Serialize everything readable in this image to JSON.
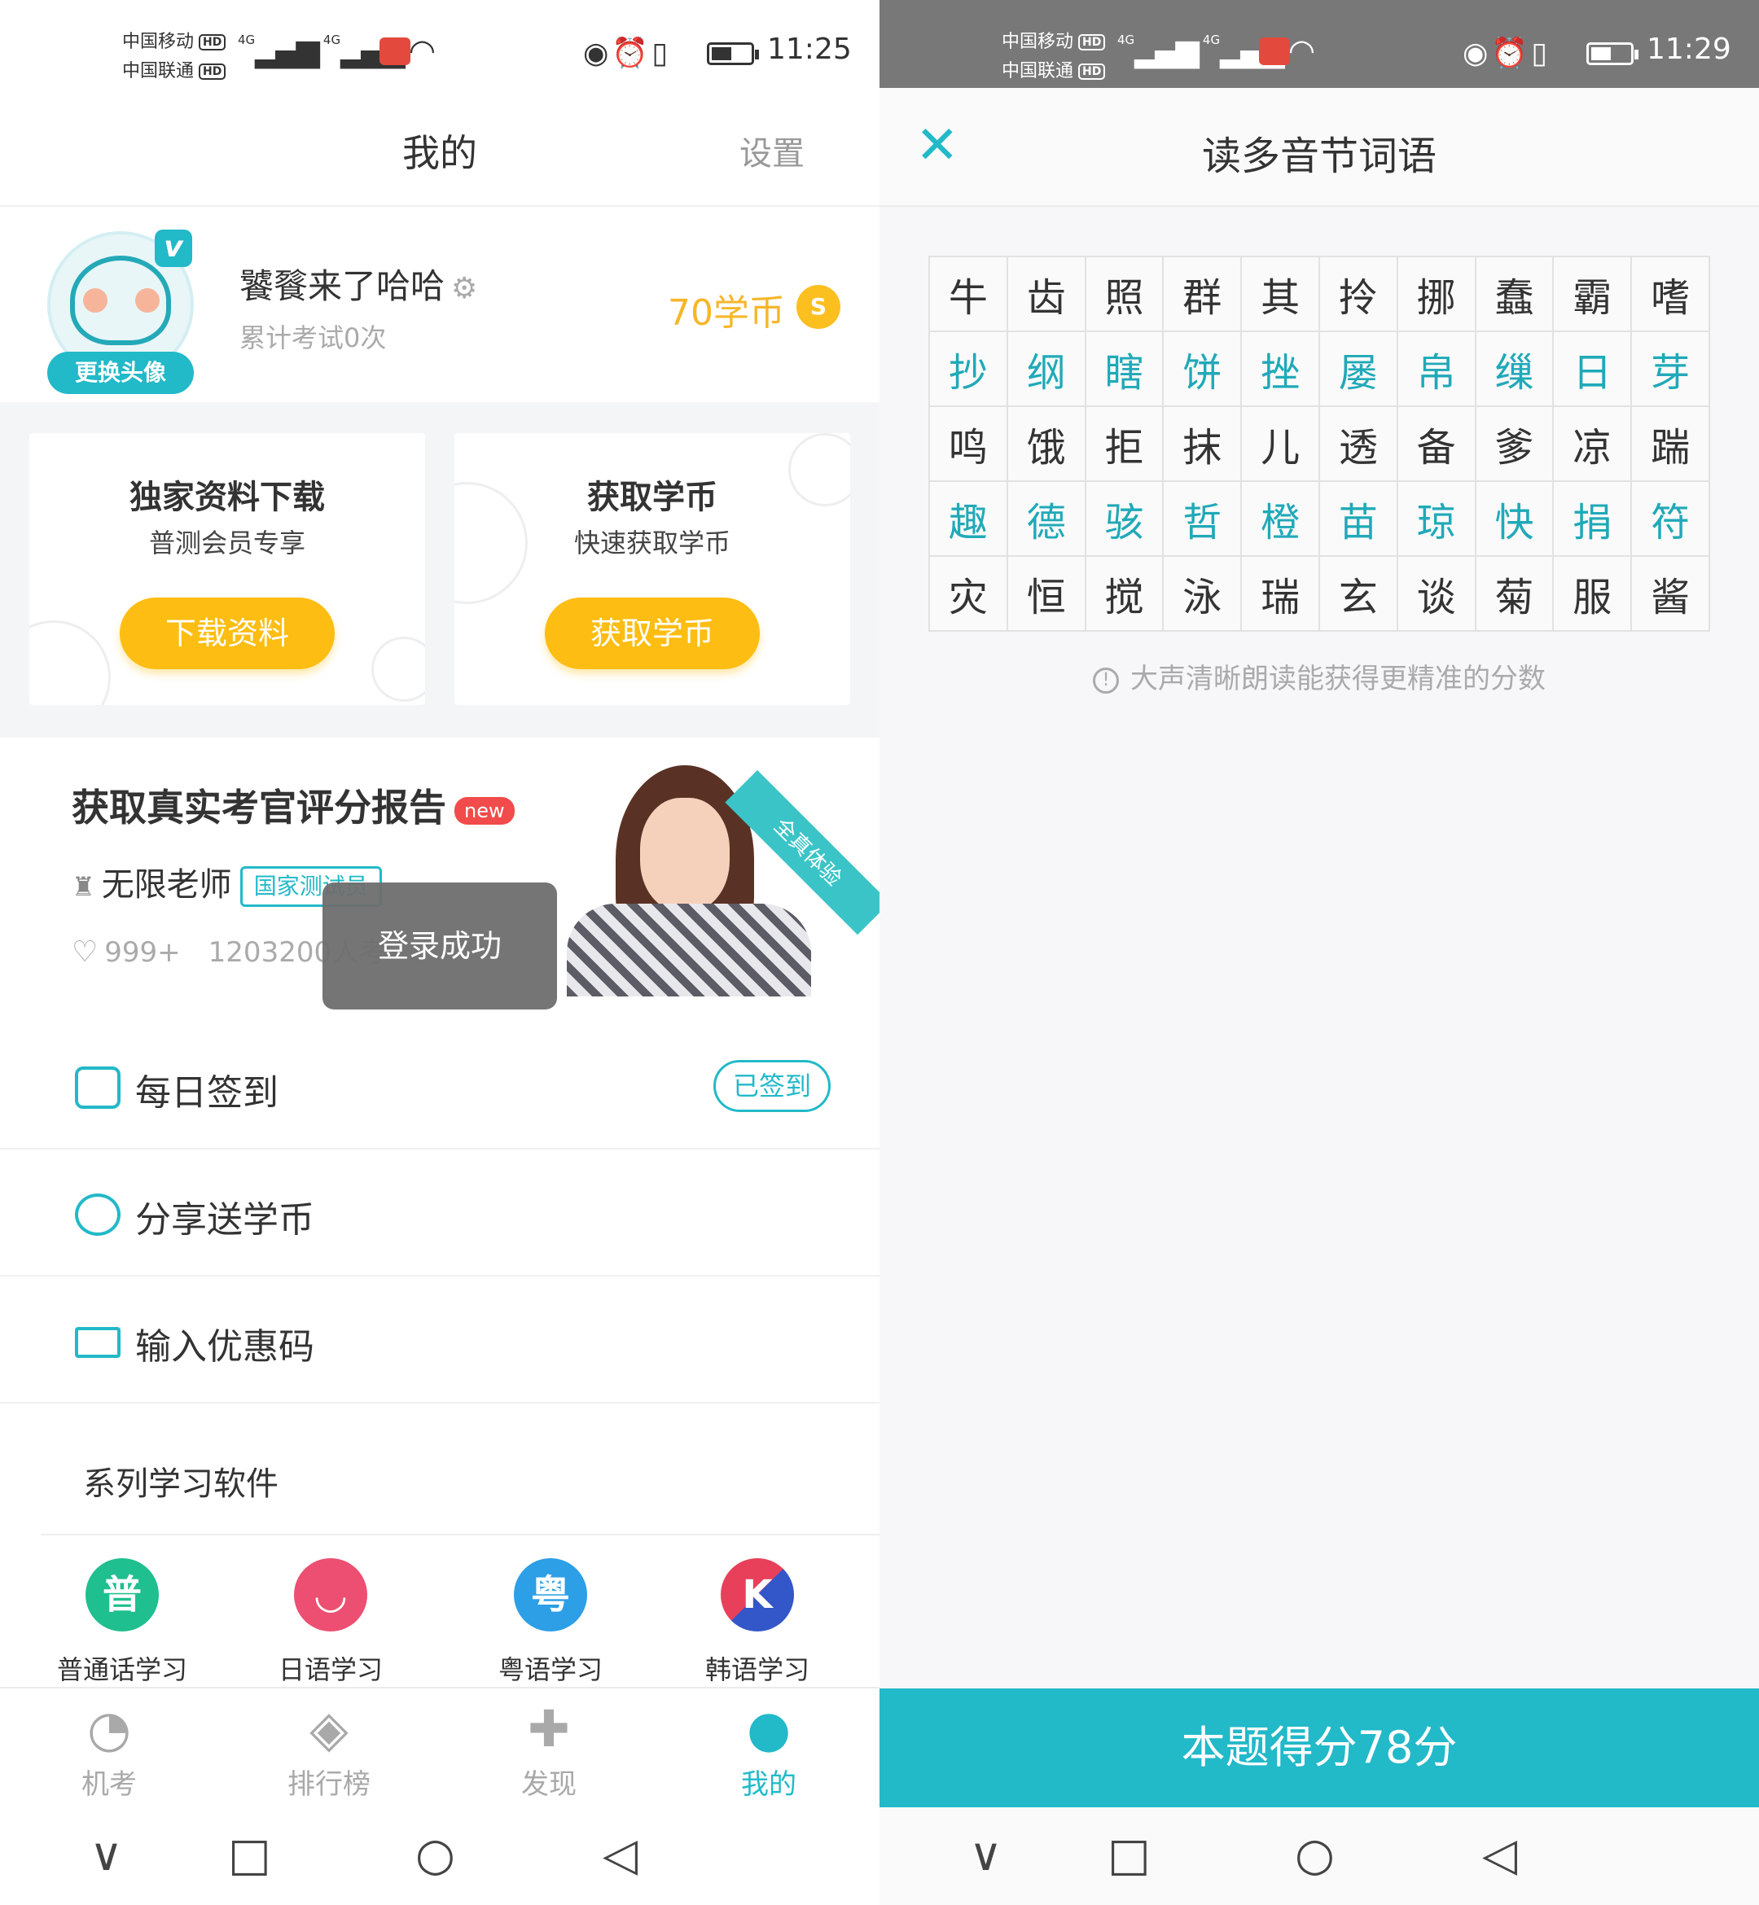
{
  "left": {
    "status": {
      "carrier1": "中国移动",
      "carrier2": "中国联通",
      "hd": "HD",
      "net": "4G",
      "time": "11:25"
    },
    "header": {
      "title": "我的",
      "settings": "设置"
    },
    "profile": {
      "change_avatar": "更换头像",
      "vip_badge": "v",
      "username": "饕餮来了哈哈",
      "exam_count": "累计考试0次",
      "coins": "70学币",
      "coin_icon": "S"
    },
    "cards": [
      {
        "title": "独家资料下载",
        "subtitle": "普测会员专享",
        "button": "下载资料"
      },
      {
        "title": "获取学币",
        "subtitle": "快速获取学币",
        "button": "获取学币"
      }
    ],
    "report": {
      "title": "获取真实考官评分报告",
      "new_tag": "new",
      "teacher": "无限老师",
      "teacher_tag": "国家测试员",
      "likes": "999+",
      "participants": "1203200人考",
      "ribbon": "全真体验"
    },
    "toast": "登录成功",
    "menu": [
      {
        "label": "每日签到",
        "badge": "已签到"
      },
      {
        "label": "分享送学币"
      },
      {
        "label": "输入优惠码"
      }
    ],
    "series": {
      "heading": "系列学习软件",
      "apps": [
        {
          "label": "普通话学习",
          "glyph": "普",
          "color": "#1fbf8f"
        },
        {
          "label": "日语学习",
          "glyph": "◡",
          "color": "#ec4f71"
        },
        {
          "label": "粤语学习",
          "glyph": "粤",
          "color": "#2c9fe6"
        },
        {
          "label": "韩语学习",
          "glyph": "K",
          "color": "#e8405a"
        }
      ]
    },
    "tabs": [
      {
        "label": "机考",
        "icon": "◔"
      },
      {
        "label": "排行榜",
        "icon": "◈"
      },
      {
        "label": "发现",
        "icon": "✚"
      },
      {
        "label": "我的",
        "icon": "●"
      }
    ]
  },
  "right": {
    "status": {
      "carrier1": "中国移动",
      "carrier2": "中国联通",
      "hd": "HD",
      "net": "4G",
      "time": "11:29"
    },
    "header": {
      "title": "读多音节词语",
      "close": "✕"
    },
    "rows": [
      [
        "牛",
        "齿",
        "照",
        "群",
        "其",
        "拎",
        "挪",
        "蠢",
        "霸",
        "嗜"
      ],
      [
        "抄",
        "纲",
        "瞎",
        "饼",
        "挫",
        "屡",
        "帛",
        "缫",
        "日",
        "芽"
      ],
      [
        "鸣",
        "饿",
        "拒",
        "抹",
        "儿",
        "透",
        "备",
        "爹",
        "凉",
        "踹"
      ],
      [
        "趣",
        "德",
        "骇",
        "哲",
        "橙",
        "苗",
        "琼",
        "快",
        "捐",
        "符"
      ],
      [
        "灾",
        "恒",
        "搅",
        "泳",
        "瑞",
        "玄",
        "谈",
        "菊",
        "服",
        "酱"
      ]
    ],
    "hint": "大声清晰朗读能获得更精准的分数",
    "score": "本题得分78分"
  },
  "nav": {
    "down": "∨",
    "recent": "□",
    "home": "○",
    "back": "◁"
  }
}
